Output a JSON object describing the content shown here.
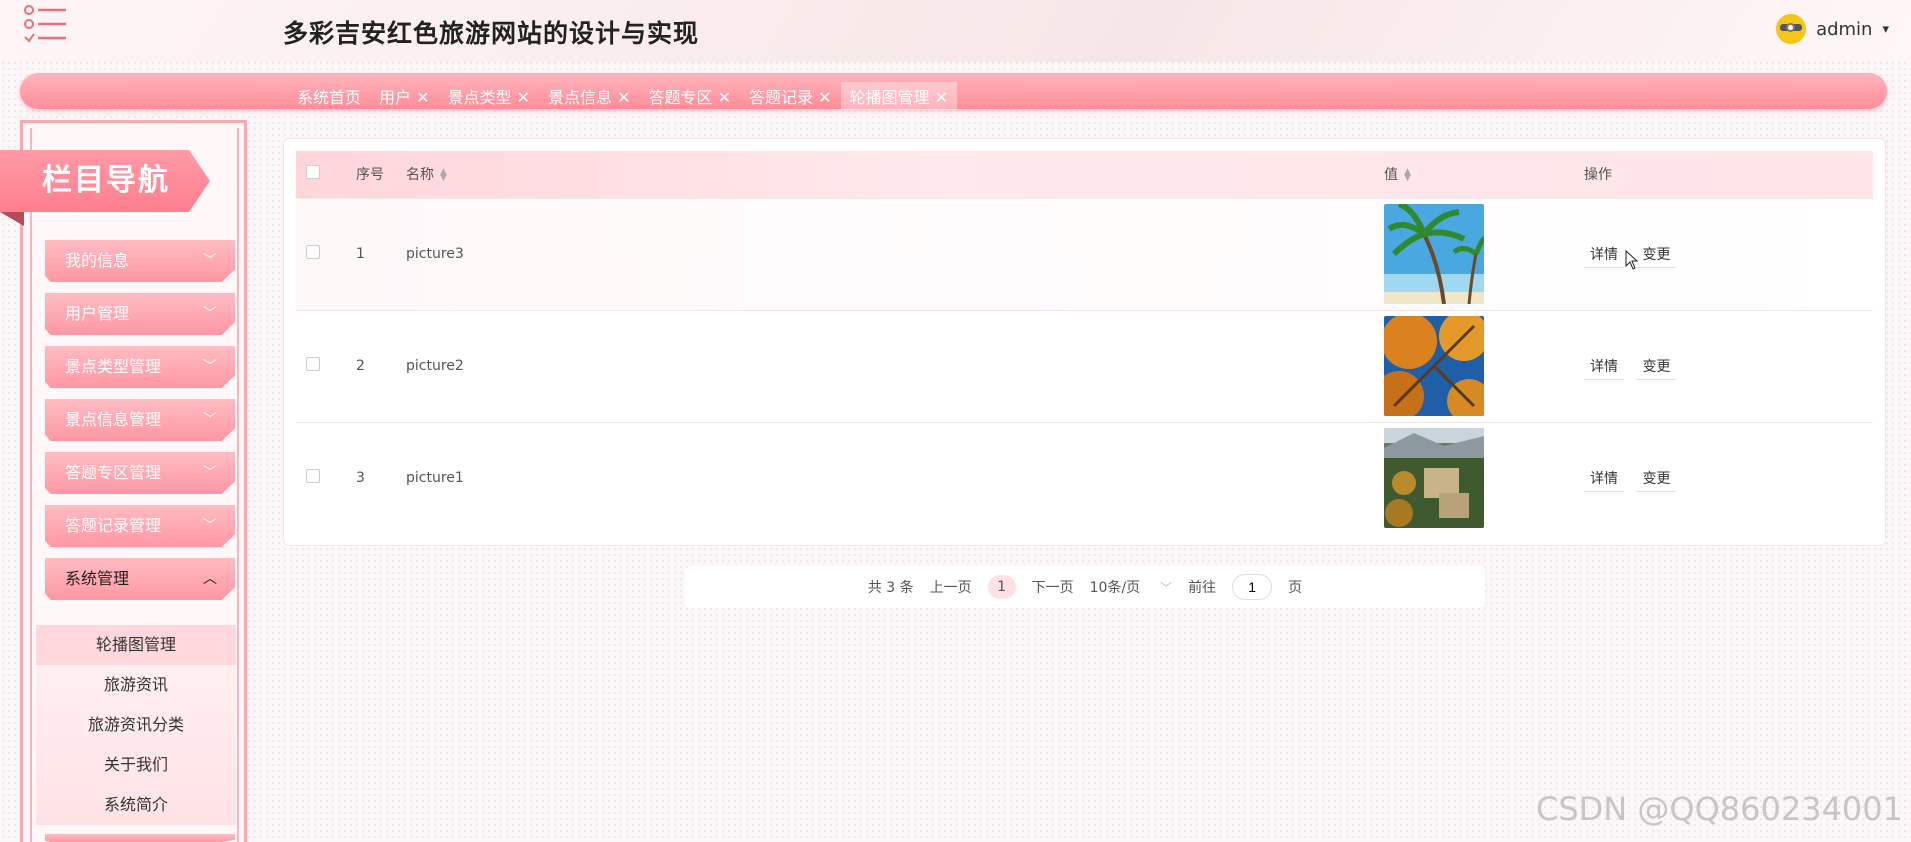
{
  "header": {
    "title": "多彩吉安红色旅游网站的设计与实现",
    "user": "admin",
    "caret": "▾"
  },
  "tabs": [
    {
      "label": "系统首页"
    },
    {
      "label": "用户 ✕"
    },
    {
      "label": "景点类型 ✕"
    },
    {
      "label": "景点信息 ✕"
    },
    {
      "label": "答题专区 ✕"
    },
    {
      "label": "答题记录 ✕"
    },
    {
      "label": "轮播图管理 ✕"
    }
  ],
  "sidebar": {
    "banner": "栏目导航",
    "items": [
      {
        "label": "我的信息"
      },
      {
        "label": "用户管理"
      },
      {
        "label": "景点类型管理"
      },
      {
        "label": "景点信息管理"
      },
      {
        "label": "答题专区管理"
      },
      {
        "label": "答题记录管理"
      },
      {
        "label": "系统管理"
      }
    ],
    "submenu": [
      {
        "label": "轮播图管理"
      },
      {
        "label": "旅游资讯"
      },
      {
        "label": "旅游资讯分类"
      },
      {
        "label": "关于我们"
      },
      {
        "label": "系统简介"
      }
    ]
  },
  "table": {
    "headers": {
      "index": "序号",
      "name": "名称",
      "value": "值",
      "actions": "操作"
    },
    "rows": [
      {
        "index": "1",
        "name": "picture3",
        "detail": "详情",
        "edit": "变更"
      },
      {
        "index": "2",
        "name": "picture2",
        "detail": "详情",
        "edit": "变更"
      },
      {
        "index": "3",
        "name": "picture1",
        "detail": "详情",
        "edit": "变更"
      }
    ]
  },
  "pagination": {
    "total": "共 3 条",
    "prev": "上一页",
    "current": "1",
    "next": "下一页",
    "size": "10条/页",
    "goto": "前往",
    "goto_value": "1",
    "page_suffix": "页"
  },
  "watermark": "CSDN @QQ860234001"
}
